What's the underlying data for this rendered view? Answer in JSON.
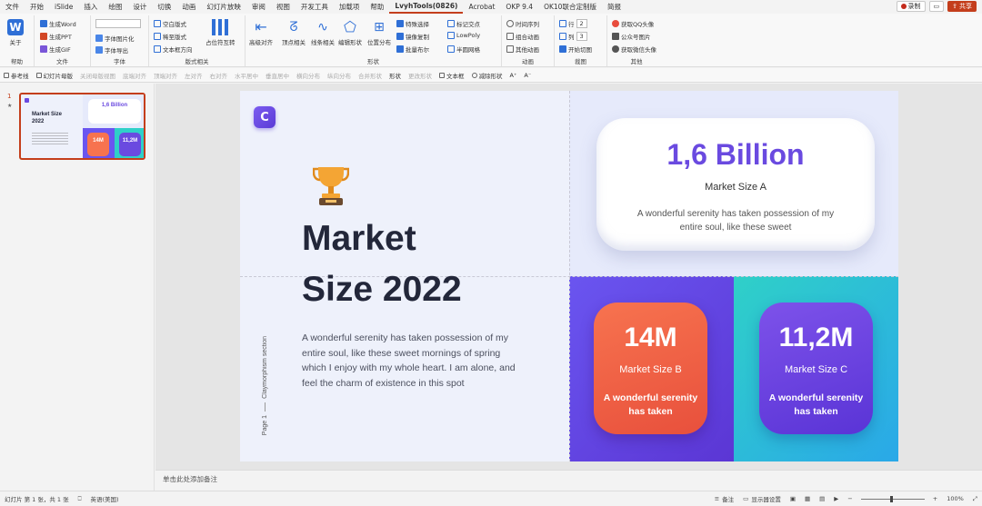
{
  "menubar": {
    "items": [
      "文件",
      "开始",
      "iSlide",
      "插入",
      "绘图",
      "设计",
      "切换",
      "动画",
      "幻灯片放映",
      "审阅",
      "视图",
      "开发工具",
      "加载项",
      "帮助",
      "LvyhTools(0826)",
      "Acrobat",
      "OKP 9.4",
      "OK10联合定制版",
      "简报"
    ],
    "active_index": 14,
    "record_label": "录制",
    "share_label": "共享",
    "accent_color": "#c43e1c"
  },
  "ribbon": {
    "groups": {
      "help": {
        "label": "帮助",
        "about": "关于"
      },
      "file": {
        "label": "文件",
        "gen_word": "生成Word",
        "gen_ppt": "生成PPT",
        "gen_gif": "生成GIF"
      },
      "font": {
        "label": "字体",
        "pic_font": "字体图片化",
        "font_export": "字体导出"
      },
      "layout": {
        "label": "版式相关",
        "blank_layout": "空白版式",
        "master_layout": "稀至版式",
        "textbox_dir": "文本框方向",
        "placeholder": "占位符互转"
      },
      "shape": {
        "label": "形状",
        "align": "高级对齐",
        "vertex": "顶点相关",
        "line": "线条相关",
        "edit_shape": "编辑形状",
        "pos": "位置分布",
        "special_select": "特殊选择",
        "mirror_copy": "镜像复制",
        "bool": "批量布尔",
        "mark_vertex": "标记交点",
        "lowpoly": "LowPoly",
        "half_circle": "半圆网格"
      },
      "anim": {
        "label": "动画",
        "time_seq": "时间序列",
        "combo_anim": "组合动画",
        "other_anim": "其他动画"
      },
      "grid": {
        "label": "裁图",
        "row": "行",
        "col": "列",
        "row_val": "2",
        "col_val": "3",
        "start_cut": "开始切图"
      },
      "other": {
        "label": "其他",
        "qq_avatar": "获取QQ头像",
        "public_pic": "公众号图片",
        "wechat_avatar": "获取微信头像"
      }
    }
  },
  "quick_toolbar": {
    "items": [
      {
        "label": "参考线",
        "dim": false
      },
      {
        "label": "幻灯片母版",
        "dim": false
      },
      {
        "label": "关闭母版视图",
        "dim": true
      },
      {
        "label": "底端对齐",
        "dim": true
      },
      {
        "label": "顶端对齐",
        "dim": true
      },
      {
        "label": "左对齐",
        "dim": true
      },
      {
        "label": "右对齐",
        "dim": true
      },
      {
        "label": "水平居中",
        "dim": true
      },
      {
        "label": "垂直居中",
        "dim": true
      },
      {
        "label": "横向分布",
        "dim": true
      },
      {
        "label": "纵向分布",
        "dim": true
      },
      {
        "label": "合并形状",
        "dim": true
      },
      {
        "label": "形状",
        "dim": false
      },
      {
        "label": "更改形状",
        "dim": true
      },
      {
        "label": "文本框",
        "dim": false
      },
      {
        "label": "减除形状",
        "dim": false
      },
      {
        "label": "A⁺",
        "dim": false
      },
      {
        "label": "A⁻",
        "dim": false
      }
    ]
  },
  "thumbnails": {
    "slide_number": "1",
    "star": "★",
    "mini": {
      "title": "Market Size 2022",
      "a_value": "1,6 Billion",
      "b_value": "14M",
      "c_value": "11,2M"
    }
  },
  "slide": {
    "logo_letter": "C",
    "title_line1": "Market",
    "title_line2": "Size 2022",
    "body": "A wonderful serenity has taken possession of my entire soul, like these sweet mornings of spring which I enjoy with my whole heart. I am alone, and feel the charm of existence in this spot",
    "vertical_section": "Claymorphism section",
    "vertical_page": "Page 1",
    "card_a": {
      "value": "1,6 Billion",
      "label": "Market Size A",
      "desc": "A wonderful serenity has taken possession of my entire soul, like these sweet"
    },
    "card_b": {
      "value": "14M",
      "label": "Market Size B",
      "desc": "A wonderful serenity has taken"
    },
    "card_c": {
      "value": "11,2M",
      "label": "Market Size C",
      "desc": "A wonderful serenity has taken"
    },
    "colors": {
      "accent_purple": "#6a4ae0",
      "orange": "#f7734f",
      "teal": "#2fd0c8"
    }
  },
  "notes": {
    "placeholder": "单击此处添加备注"
  },
  "statusbar": {
    "slide_info": "幻灯片 第 1 张，共 1 张",
    "language": "英语(美国)",
    "notes_label": "备注",
    "display_label": "显示器设置",
    "zoom": "100%"
  }
}
